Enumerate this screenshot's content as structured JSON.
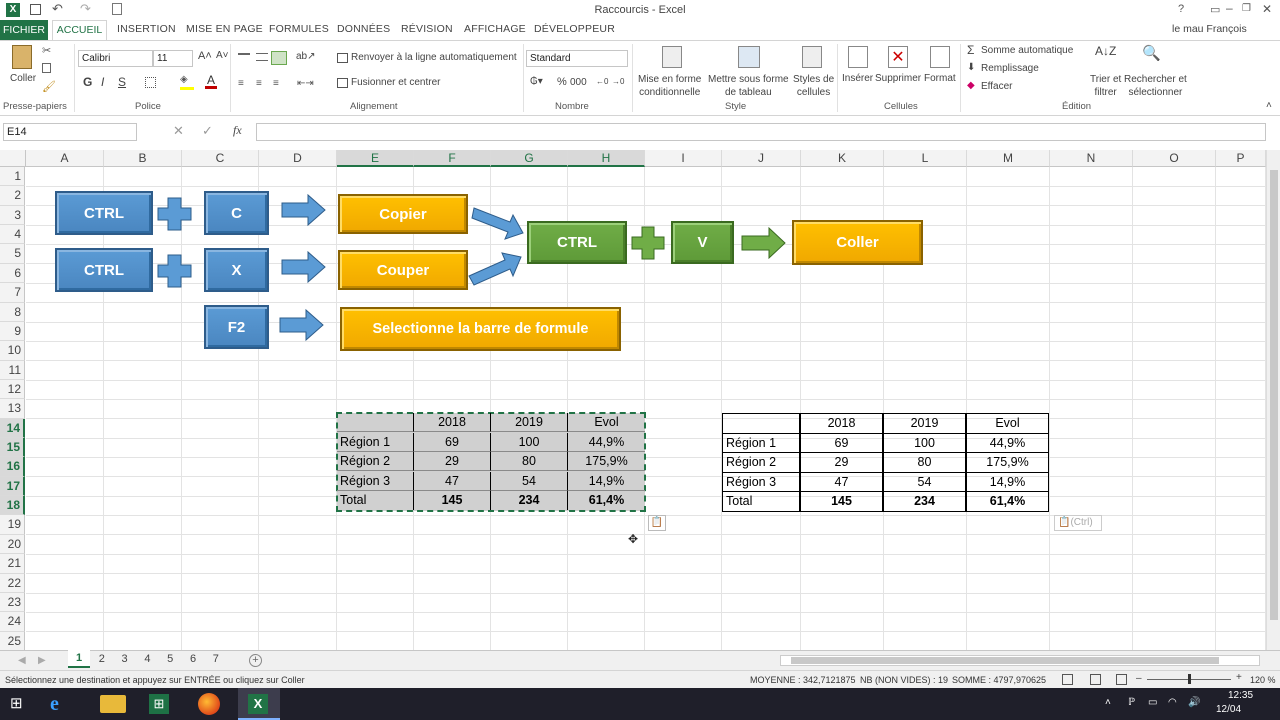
{
  "window": {
    "title": "Raccourcis - Excel",
    "user": "le mau François"
  },
  "tabs": [
    "FICHIER",
    "ACCUEIL",
    "INSERTION",
    "MISE EN PAGE",
    "FORMULES",
    "DONNÉES",
    "RÉVISION",
    "AFFICHAGE",
    "DÉVELOPPEUR"
  ],
  "ribbon": {
    "paste": "Coller",
    "clipboard": "Presse-papiers",
    "font_name": "Calibri",
    "font_size": "11",
    "font_group": "Police",
    "bold": "G",
    "italic": "I",
    "underline": "S",
    "wrap": "Renvoyer à la ligne automatiquement",
    "merge": "Fusionner et centrer",
    "align_group": "Alignement",
    "number_format": "Standard",
    "number_group": "Nombre",
    "cond_format": "Mise en forme\nconditionnelle",
    "table_format": "Mettre sous forme\nde tableau",
    "cell_styles": "Styles de\ncellules",
    "style_group": "Style",
    "insert": "Insérer",
    "delete": "Supprimer",
    "format": "Format",
    "cells_group": "Cellules",
    "autosum": "Somme automatique",
    "fill": "Remplissage",
    "clear": "Effacer",
    "sort": "Trier et\nfiltrer",
    "find": "Rechercher et\nsélectionner",
    "edit_group": "Édition"
  },
  "formula_bar": {
    "name_box": "E14",
    "fx": "fx",
    "value": ""
  },
  "columns": [
    "A",
    "B",
    "C",
    "D",
    "E",
    "F",
    "G",
    "H",
    "I",
    "J",
    "K",
    "L",
    "M",
    "N",
    "O",
    "P"
  ],
  "rows": [
    "1",
    "2",
    "3",
    "4",
    "5",
    "6",
    "7",
    "8",
    "9",
    "10",
    "11",
    "12",
    "13",
    "14",
    "15",
    "16",
    "17",
    "18",
    "19",
    "20",
    "21",
    "22",
    "23",
    "24",
    "25"
  ],
  "diagram": {
    "ctrl1": "CTRL",
    "c": "C",
    "copier": "Copier",
    "ctrl2": "CTRL",
    "x": "X",
    "couper": "Couper",
    "f2": "F2",
    "formula": "Selectionne la barre de formule",
    "ctrl3": "CTRL",
    "v": "V",
    "coller": "Coller"
  },
  "table1": {
    "header": [
      "",
      "2018",
      "2019",
      "Evol"
    ],
    "rows": [
      [
        "Région 1",
        "69",
        "100",
        "44,9%"
      ],
      [
        "Région 2",
        "29",
        "80",
        "175,9%"
      ],
      [
        "Région 3",
        "47",
        "54",
        "14,9%"
      ],
      [
        "Total",
        "145",
        "234",
        "61,4%"
      ]
    ]
  },
  "table2": {
    "header": [
      "",
      "2018",
      "2019",
      "Evol"
    ],
    "rows": [
      [
        "Région 1",
        "69",
        "100",
        "44,9%"
      ],
      [
        "Région 2",
        "29",
        "80",
        "175,9%"
      ],
      [
        "Région 3",
        "47",
        "54",
        "14,9%"
      ],
      [
        "Total",
        "145",
        "234",
        "61,4%"
      ]
    ]
  },
  "paste_tag": "(Ctrl)",
  "sheets": [
    "1",
    "2",
    "3",
    "4",
    "5",
    "6",
    "7"
  ],
  "status": {
    "message": "Sélectionnez une destination et appuyez sur ENTRÉE ou cliquez sur Coller",
    "average": "MOYENNE : 342,7121875",
    "count": "NB (NON VIDES) : 19",
    "sum": "SOMME : 4797,970625",
    "zoom": "120 %"
  },
  "taskbar": {
    "time": "12:35",
    "date": "12/04"
  }
}
